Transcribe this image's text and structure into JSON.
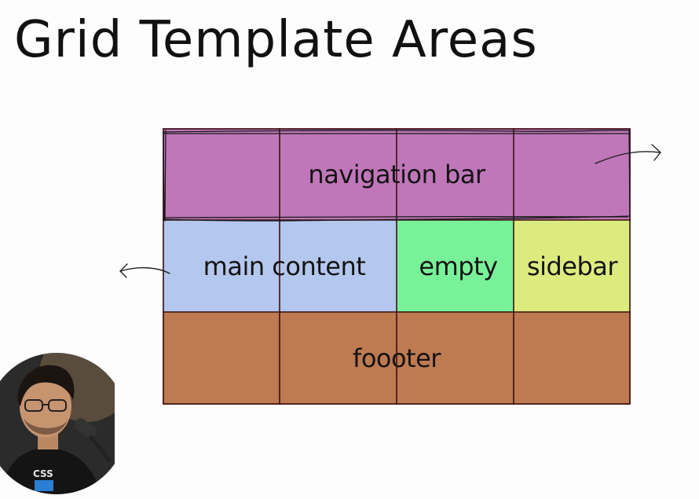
{
  "title": "Grid Template Areas",
  "areas": {
    "navigation": {
      "label": "navigation bar",
      "color": "#c077b9"
    },
    "main": {
      "label": "main content",
      "color": "#b4c7ee"
    },
    "empty": {
      "label": "empty",
      "color": "#79f199"
    },
    "sidebar": {
      "label": "sidebar",
      "color": "#dceb7e"
    },
    "footer": {
      "label": "foooter",
      "color": "#be7a51"
    }
  },
  "grid": {
    "columns": 4,
    "rows": 3,
    "line_color": "#5a1010"
  },
  "webcam": {
    "shirt_text": "CSS"
  }
}
